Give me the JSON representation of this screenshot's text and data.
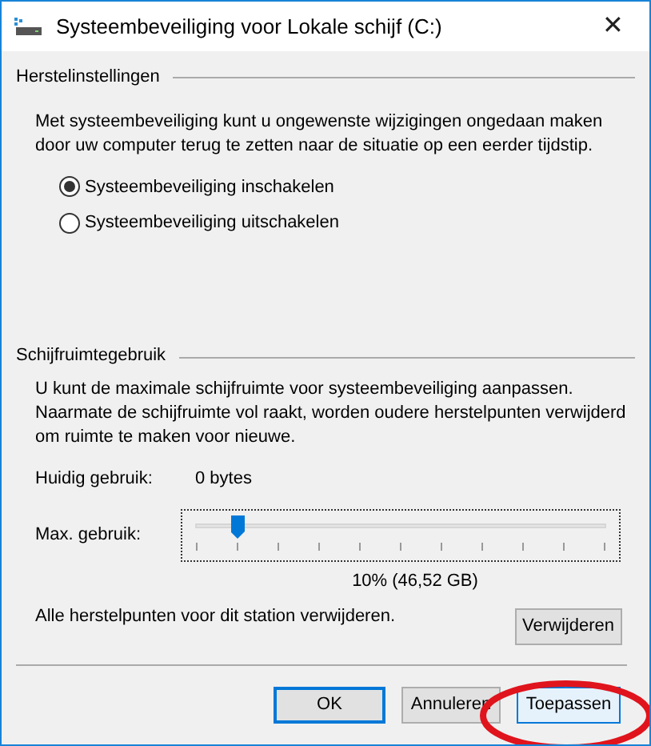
{
  "window": {
    "title": "Systeembeveiliging voor Lokale schijf (C:)",
    "close": "✕"
  },
  "restore_settings": {
    "heading": "Herstelinstellingen",
    "description": "Met systeembeveiliging kunt u ongewenste wijzigingen ongedaan maken door uw computer terug te zetten naar de situatie op een eerder tijdstip.",
    "options": [
      {
        "label": "Systeembeveiliging inschakelen",
        "selected": true
      },
      {
        "label": "Systeembeveiliging uitschakelen",
        "selected": false
      }
    ]
  },
  "disk_usage": {
    "heading": "Schijfruimtegebruik",
    "description": "U kunt de maximale schijfruimte voor systeembeveiliging aanpassen. Naarmate de schijfruimte vol raakt, worden oudere herstelpunten verwijderd om ruimte te maken voor nieuwe.",
    "current_label": "Huidig gebruik:",
    "current_value": "0 bytes",
    "max_label": "Max. gebruik:",
    "max_slider": {
      "level": 0.1
    },
    "max_reading": "10% (46,52 GB)",
    "delete_text": "Alle herstelpunten voor dit station verwijderen.",
    "delete_button": "Verwijderen"
  },
  "buttons": [
    {
      "label": "OK",
      "default": true,
      "highlighted": false
    },
    {
      "label": "Annuleren",
      "default": false,
      "highlighted": false
    },
    {
      "label": "Toepassen",
      "default": false,
      "highlighted": true
    }
  ]
}
